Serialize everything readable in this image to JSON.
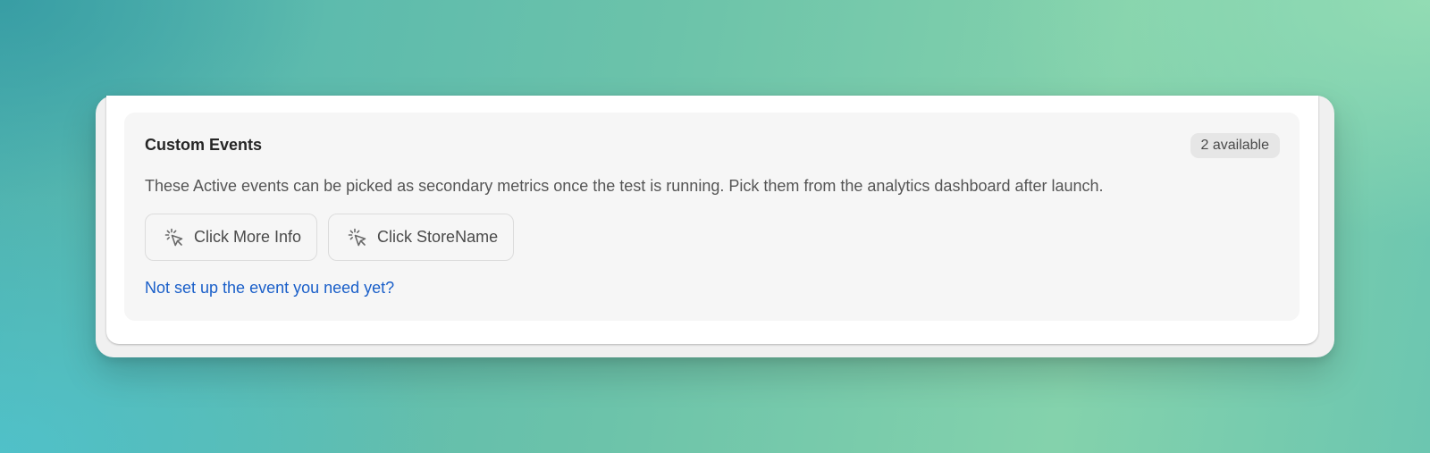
{
  "custom_events": {
    "title": "Custom Events",
    "badge": "2 available",
    "description": "These Active events can be picked as secondary metrics once the test is running. Pick them from the analytics dashboard after launch.",
    "events": [
      {
        "label": "Click More Info",
        "icon": "cursor-click-icon"
      },
      {
        "label": "Click StoreName",
        "icon": "cursor-click-icon"
      }
    ],
    "help_link": "Not set up the event you need yet?"
  },
  "colors": {
    "link": "#1a5fc9",
    "panel_background": "#f6f6f6",
    "badge_background": "#e6e6e6"
  }
}
